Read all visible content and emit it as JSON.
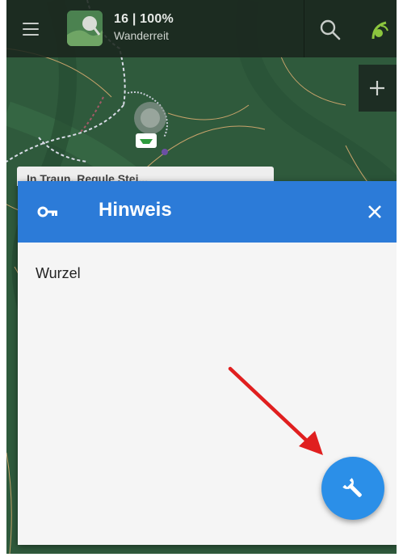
{
  "topbar": {
    "zoom_line": "16 | 100%",
    "layer_name": "Wanderreit"
  },
  "behind_card": {
    "title": "In Traun, Regule Stei..."
  },
  "dialog": {
    "title": "Hinweis",
    "body_text": "Wurzel"
  },
  "icons": {
    "menu": "hamburger-menu-icon",
    "search": "search-icon",
    "gps": "gps-satellite-icon",
    "zoom_in": "plus-icon",
    "dialog_header": "key-icon",
    "close": "close-icon",
    "fab": "wrench-icon"
  },
  "colors": {
    "header_blue": "#2c7bd8",
    "fab_blue": "#2b8fe8",
    "topbar": "#1a261e",
    "map_green": "#2f5a3c",
    "annotation_arrow": "#e01f1f"
  }
}
